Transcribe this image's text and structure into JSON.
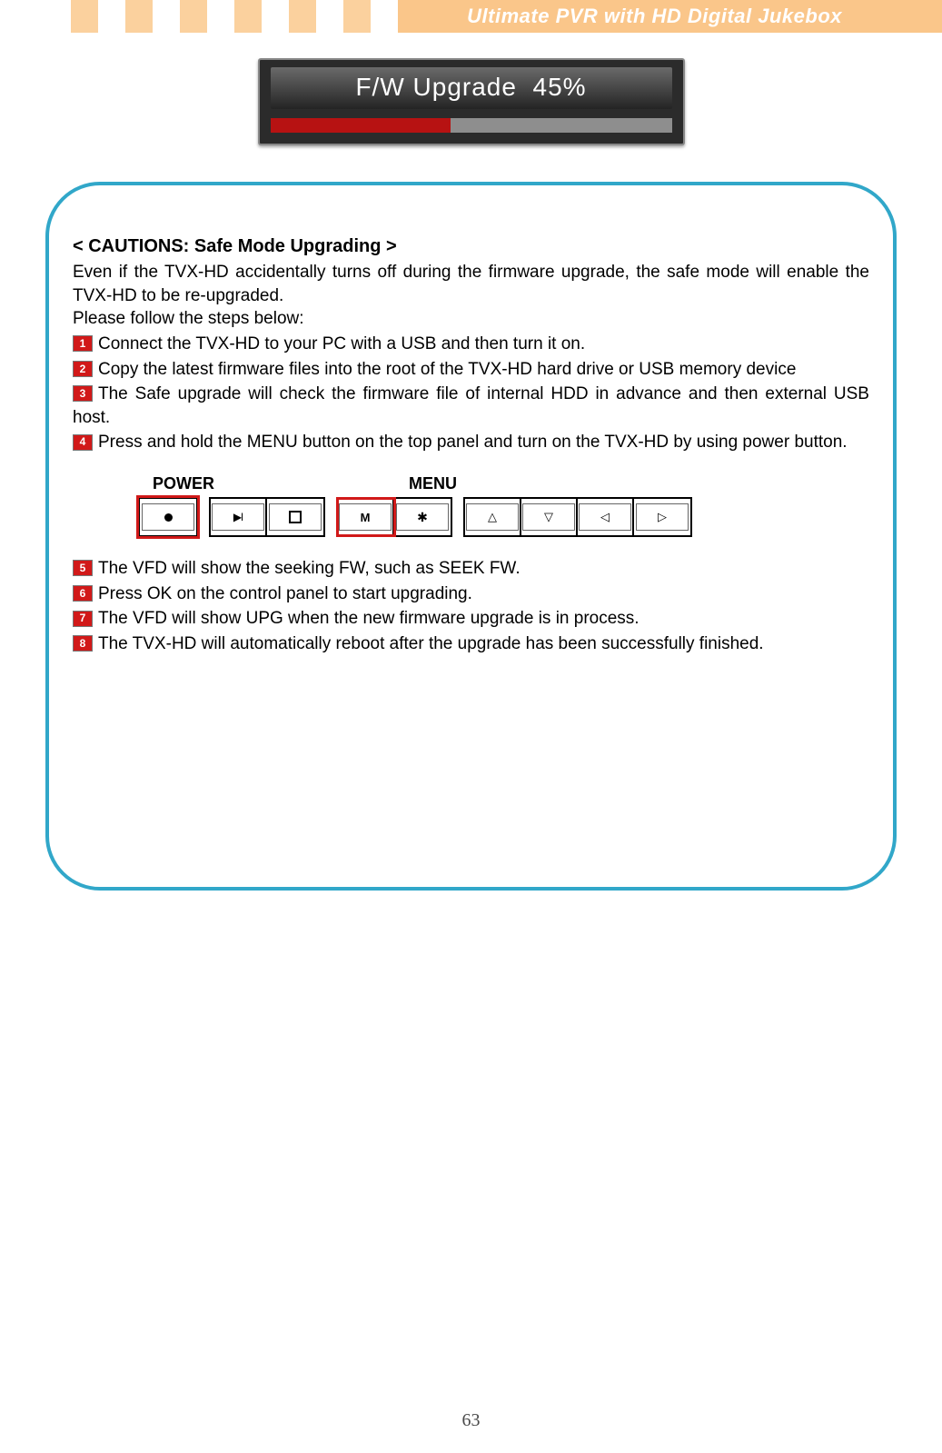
{
  "header": {
    "title": "Ultimate PVR with HD Digital Jukebox"
  },
  "progress": {
    "label": "F/W Upgrade  45%",
    "percent": 45
  },
  "caution": {
    "heading": "< CAUTIONS: Safe Mode Upgrading >",
    "intro1": "Even if the TVX-HD accidentally turns off during the firmware upgrade, the safe mode will enable the TVX-HD to be re-upgraded.",
    "intro2": "Please follow the steps below:",
    "steps_a": [
      "Connect the TVX-HD to your PC with a USB and then turn it on.",
      "Copy the latest firmware files into the root of the TVX-HD hard drive or USB memory device",
      "The Safe upgrade will check the firmware file of internal HDD in advance and then external USB host.",
      "Press and hold the MENU button on the top panel and turn on the TVX-HD by using power button."
    ],
    "panel": {
      "power_label": "POWER",
      "menu_label": "MENU"
    },
    "steps_b": [
      "The VFD will show the seeking FW, such as SEEK FW.",
      "Press OK on the control panel to start upgrading.",
      "The VFD will show UPG when the new firmware upgrade is in process.",
      "The TVX-HD will automatically reboot after the upgrade has been successfully finished."
    ]
  },
  "page_number": "63"
}
